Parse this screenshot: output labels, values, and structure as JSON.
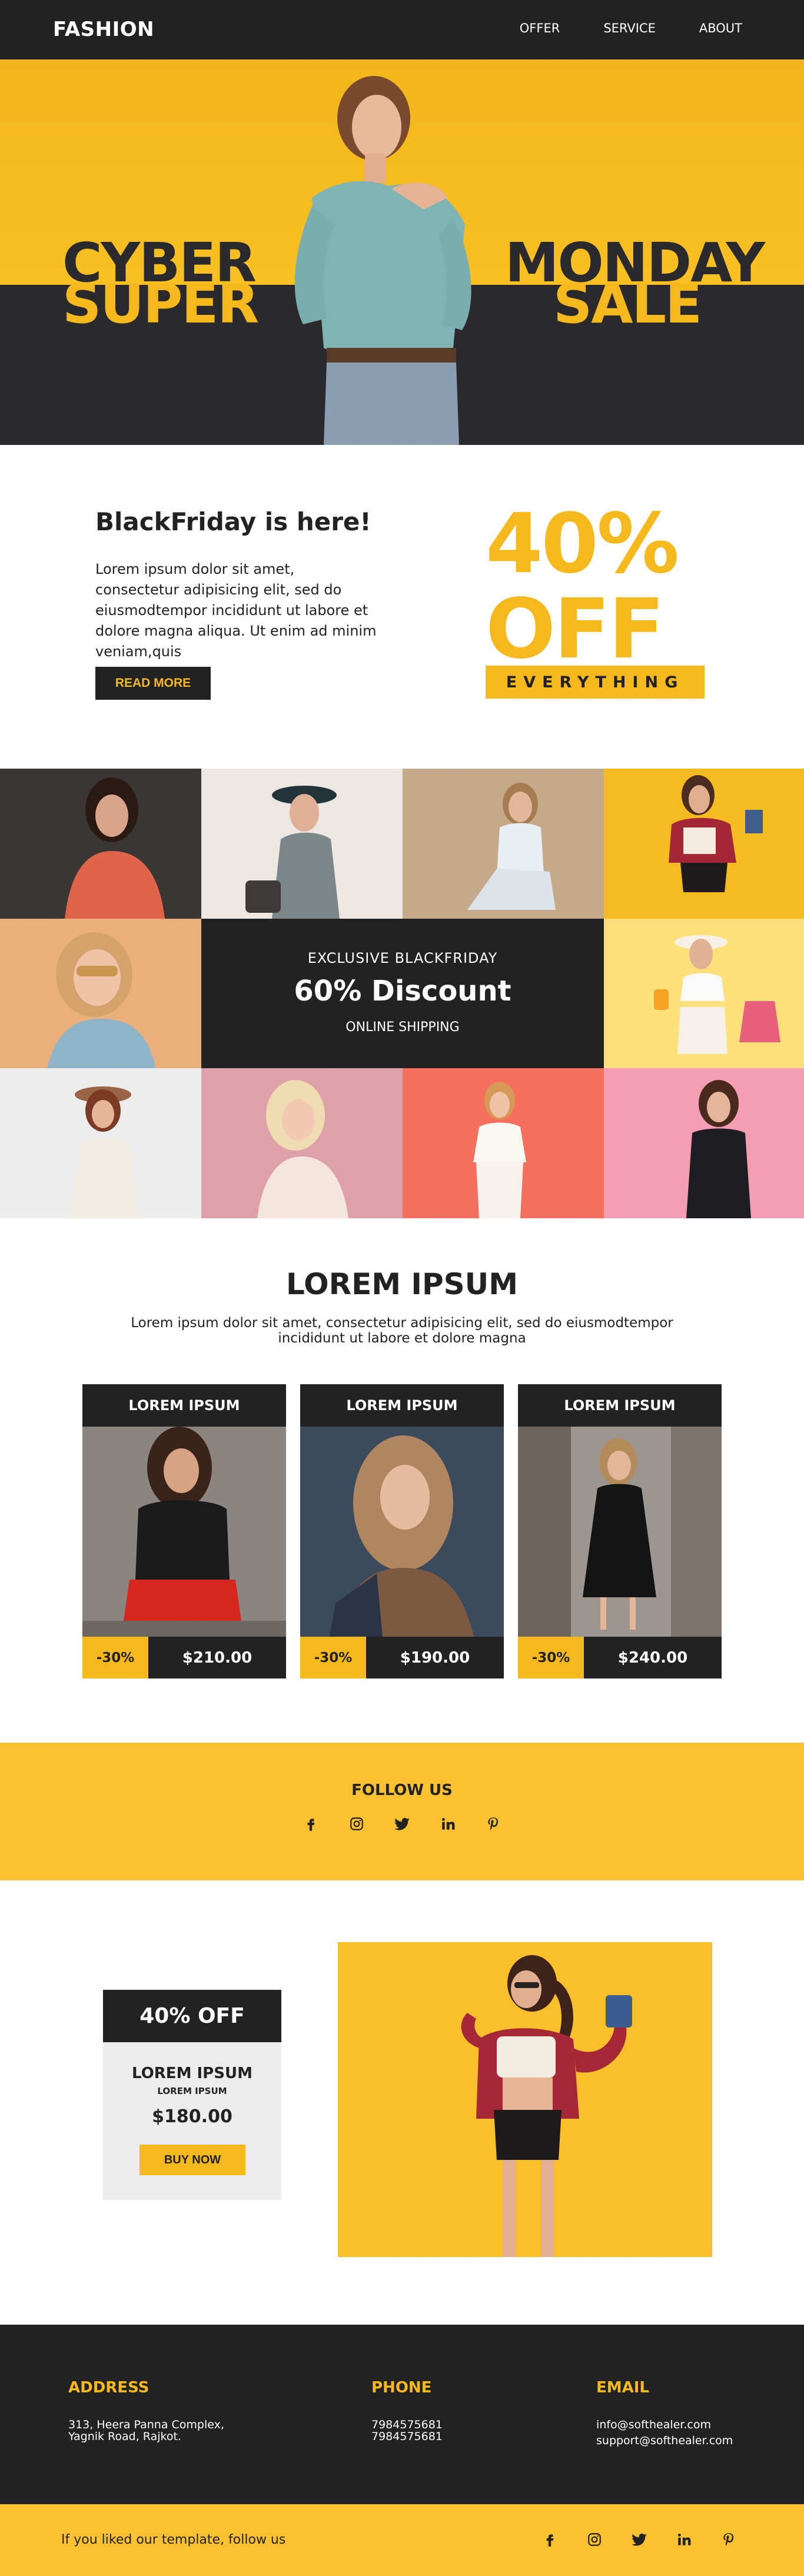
{
  "nav": {
    "logo": "FASHION",
    "links": [
      "OFFER",
      "SERVICE",
      "ABOUT"
    ]
  },
  "hero": {
    "words": [
      "CYBER",
      "SUPER",
      "MONDAY",
      "SALE"
    ]
  },
  "black_friday": {
    "title": "BlackFriday is here!",
    "text": "Lorem ipsum dolor sit amet, consectetur adipisicing elit, sed do eiusmodtempor incididunt ut labore et dolore magna aliqua. Ut enim ad minim veniam,quis",
    "button": "READ MORE",
    "big_percent": "40%",
    "big_off": "OFF",
    "banner": "EVERYTHING"
  },
  "promo": {
    "line1": "EXCLUSIVE  BLACKFRIDAY",
    "line2": "60% Discount",
    "line3": "ONLINE SHIPPING"
  },
  "products_section": {
    "title": "LOREM IPSUM",
    "text": "Lorem ipsum dolor sit amet, consectetur adipisicing elit, sed do eiusmodtempor incididunt ut labore et dolore magna",
    "cards": [
      {
        "title": "LOREM IPSUM",
        "discount": "-30%",
        "price": "$210.00"
      },
      {
        "title": "LOREM IPSUM",
        "discount": "-30%",
        "price": "$190.00"
      },
      {
        "title": "LOREM IPSUM",
        "discount": "-30%",
        "price": "$240.00"
      }
    ]
  },
  "follow": {
    "title": "FOLLOW US",
    "icons": [
      "facebook-icon",
      "instagram-icon",
      "twitter-icon",
      "linkedin-icon",
      "pinterest-icon"
    ]
  },
  "offer": {
    "head": "40% OFF",
    "name": "LOREM IPSUM",
    "sub": "LOREM IPSUM",
    "price": "$180.00",
    "button": "BUY NOW"
  },
  "footer": {
    "address_title": "ADDRESS",
    "address_lines": [
      "313, Heera Panna Complex,",
      "Yagnik Road, Rajkot."
    ],
    "phone_title": "PHONE",
    "phone_lines": [
      "7984575681",
      "7984575681"
    ],
    "email_title": "EMAIL",
    "email_lines": [
      "info@softhealer.com",
      "support@softhealer.com"
    ]
  },
  "bottom_bar": {
    "text": "If you liked our template, follow us"
  },
  "colors": {
    "accent": "#f6b91d",
    "dark": "#222222"
  }
}
